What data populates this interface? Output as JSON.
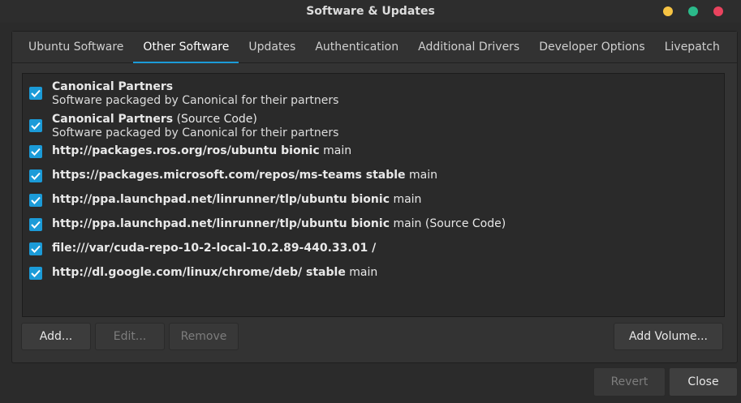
{
  "window": {
    "title": "Software & Updates"
  },
  "tabs": [
    {
      "label": "Ubuntu Software"
    },
    {
      "label": "Other Software"
    },
    {
      "label": "Updates"
    },
    {
      "label": "Authentication"
    },
    {
      "label": "Additional Drivers"
    },
    {
      "label": "Developer Options"
    },
    {
      "label": "Livepatch"
    }
  ],
  "active_tab": "Other Software",
  "sources": [
    {
      "checked": true,
      "bold": "Canonical Partners",
      "rest": "",
      "sub": "Software packaged by Canonical for their partners"
    },
    {
      "checked": true,
      "bold": "Canonical Partners",
      "rest": " (Source Code)",
      "sub": "Software packaged by Canonical for their partners"
    },
    {
      "checked": true,
      "bold": "http://packages.ros.org/ros/ubuntu bionic",
      "rest": " main",
      "sub": ""
    },
    {
      "checked": true,
      "bold": "https://packages.microsoft.com/repos/ms-teams stable",
      "rest": " main",
      "sub": ""
    },
    {
      "checked": true,
      "bold": "http://ppa.launchpad.net/linrunner/tlp/ubuntu bionic",
      "rest": " main",
      "sub": ""
    },
    {
      "checked": true,
      "bold": "http://ppa.launchpad.net/linrunner/tlp/ubuntu bionic",
      "rest": " main (Source Code)",
      "sub": ""
    },
    {
      "checked": true,
      "bold": "file:///var/cuda-repo-10-2-local-10.2.89-440.33.01 /",
      "rest": "",
      "sub": ""
    },
    {
      "checked": true,
      "bold": "http://dl.google.com/linux/chrome/deb/ stable",
      "rest": " main",
      "sub": ""
    }
  ],
  "buttons": {
    "add": "Add...",
    "edit": "Edit...",
    "remove": "Remove",
    "add_volume": "Add Volume...",
    "revert": "Revert",
    "close": "Close"
  },
  "colors": {
    "accent": "#1b9bd8",
    "minimize": "#f6c343",
    "maximize": "#2bba8a",
    "close": "#e9435e"
  }
}
